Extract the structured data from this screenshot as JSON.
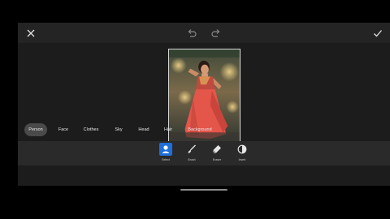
{
  "topbar": {
    "close_icon": "close-icon",
    "undo_icon": "undo-icon",
    "redo_icon": "redo-icon",
    "apply_icon": "check-icon"
  },
  "categories": [
    {
      "label": "Person",
      "active": true
    },
    {
      "label": "Face",
      "active": false
    },
    {
      "label": "Clothes",
      "active": false
    },
    {
      "label": "Sky",
      "active": false
    },
    {
      "label": "Head",
      "active": false
    },
    {
      "label": "Hair",
      "active": false
    },
    {
      "label": "Background",
      "active": false
    }
  ],
  "tools": [
    {
      "label": "Select",
      "icon": "person-select-icon",
      "active": true
    },
    {
      "label": "Brush",
      "icon": "brush-icon",
      "active": false
    },
    {
      "label": "Eraser",
      "icon": "eraser-icon",
      "active": false
    },
    {
      "label": "Invert",
      "icon": "invert-icon",
      "active": false
    }
  ],
  "colors": {
    "accent": "#1e6fd9",
    "background": "#1c1c1c",
    "toolbar": "#2a2a2a"
  }
}
